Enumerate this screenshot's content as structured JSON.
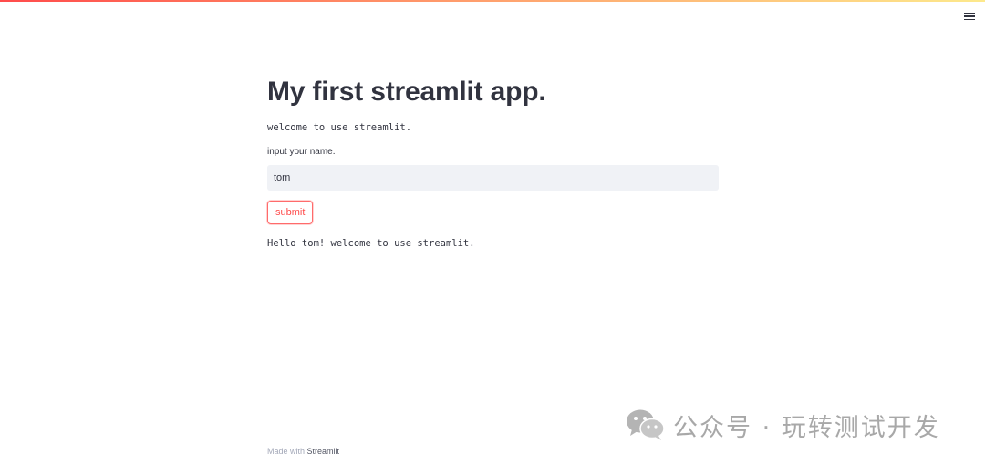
{
  "header": {
    "menu_icon": "hamburger-menu-icon"
  },
  "main": {
    "title": "My first streamlit app.",
    "welcome_text": "welcome to use streamlit.",
    "input": {
      "label": "input your name.",
      "value": "tom",
      "placeholder": ""
    },
    "submit_label": "submit",
    "output_text": "Hello tom! welcome to use streamlit."
  },
  "footer": {
    "prefix": "Made with",
    "brand": "Streamlit"
  },
  "watermark": {
    "icon": "wechat-icon",
    "text": "公众号 · 玩转测试开发"
  },
  "colors": {
    "accent": "#ff4b4b",
    "text": "#31333f",
    "input_bg": "#f0f2f6"
  }
}
